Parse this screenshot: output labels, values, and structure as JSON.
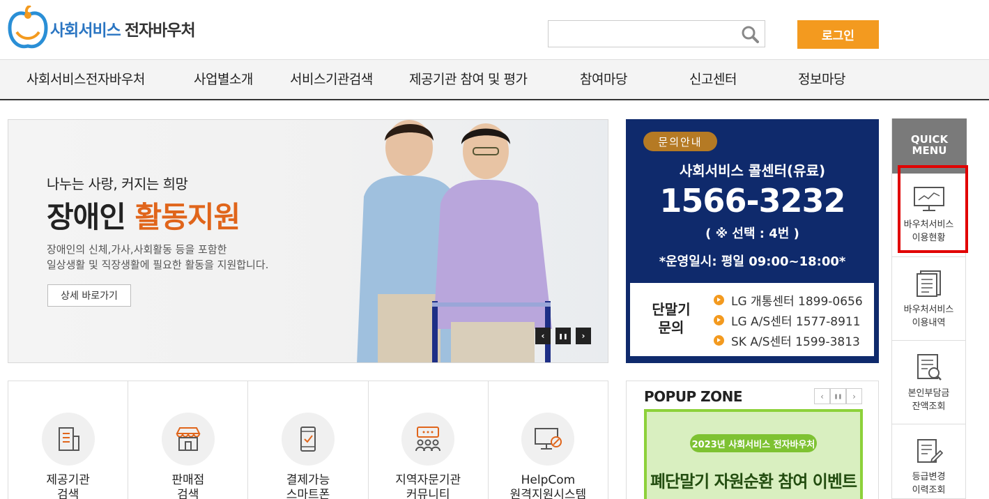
{
  "header": {
    "logo_brand": "사회서비스",
    "logo_suffix": "전자바우처",
    "search_placeholder": "",
    "login_label": "로그인"
  },
  "nav": {
    "items": [
      {
        "label": "사회서비스전자바우처"
      },
      {
        "label": "사업별소개"
      },
      {
        "label": "서비스기관검색"
      },
      {
        "label": "제공기관 참여 및 평가"
      },
      {
        "label": "참여마당"
      },
      {
        "label": "신고센터"
      },
      {
        "label": "정보마당"
      }
    ]
  },
  "banner": {
    "subtitle": "나누는 사랑, 커지는 희망",
    "title_prefix": "장애인",
    "title_highlight": "활동지원",
    "desc_line1": "장애인의 신체,가사,사회활동 등을 포함한",
    "desc_line2": "일상생활 및 직장생활에 필요한 활동을 지원합니다.",
    "button_label": "상세 바로가기",
    "prev": "‹",
    "pause": "❚❚",
    "next": "›"
  },
  "call_center": {
    "badge": "문의안내",
    "title": "사회서비스 콜센터(유료)",
    "number": "1566-3232",
    "select": "( ※ 선택 : 4번 )",
    "hours": "*운영일시: 평일 09:00~18:00*",
    "terminal_label_line1": "단말기",
    "terminal_label_line2": "문의",
    "terminals": [
      {
        "text": "LG 개통센터 1899-0656"
      },
      {
        "text": "LG A/S센터 1577-8911"
      },
      {
        "text": "SK A/S센터 1599-3813"
      }
    ]
  },
  "quick_menu": {
    "header_line1": "QUICK",
    "header_line2": "MENU",
    "items": [
      {
        "line1": "바우처서비스",
        "line2": "이용현황",
        "icon": "monitor-chart-icon"
      },
      {
        "line1": "바우처서비스",
        "line2": "이용내역",
        "icon": "document-list-icon"
      },
      {
        "line1": "본인부담금",
        "line2": "잔액조회",
        "icon": "document-search-icon"
      },
      {
        "line1": "등급변경",
        "line2": "이력조회",
        "icon": "document-edit-icon"
      }
    ]
  },
  "service_icons": [
    {
      "line1": "제공기관",
      "line2": "검색",
      "icon": "building-icon"
    },
    {
      "line1": "판매점",
      "line2": "검색",
      "icon": "store-icon"
    },
    {
      "line1": "결제가능",
      "line2": "스마트폰",
      "icon": "smartphone-icon"
    },
    {
      "line1": "지역자문기관",
      "line2": "커뮤니티",
      "icon": "community-icon"
    },
    {
      "line1": "HelpCom",
      "line2": "원격지원시스템",
      "icon": "remote-support-icon"
    }
  ],
  "popup_zone": {
    "title": "POPUP ZONE",
    "prev": "‹",
    "pause": "❚❚",
    "next": "›",
    "banner_pill": "2023년 사회서비스 전자바우처",
    "banner_headline": "폐단말기 자원순환 참여 이벤트"
  },
  "colors": {
    "accent_orange": "#f39a1f",
    "navy": "#0f2a6c",
    "highlight_red": "#e10000",
    "brand_blue": "#2a75c2"
  }
}
